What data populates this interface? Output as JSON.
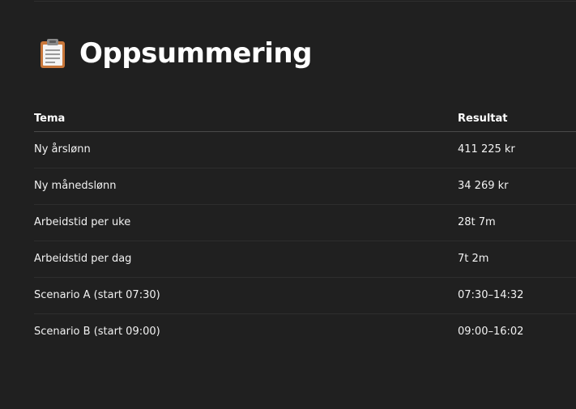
{
  "header": {
    "icon": "clipboard-icon",
    "title": "Oppsummering"
  },
  "table": {
    "columns": [
      "Tema",
      "Resultat"
    ],
    "rows": [
      {
        "tema": "Ny årslønn",
        "resultat": "411 225 kr"
      },
      {
        "tema": "Ny månedslønn",
        "resultat": "34 269 kr"
      },
      {
        "tema": "Arbeidstid per uke",
        "resultat": "28t 7m"
      },
      {
        "tema": "Arbeidstid per dag",
        "resultat": "7t 2m"
      },
      {
        "tema": "Scenario A (start 07:30)",
        "resultat": "07:30–14:32"
      },
      {
        "tema": "Scenario B (start 09:00)",
        "resultat": "09:00–16:02"
      }
    ]
  }
}
